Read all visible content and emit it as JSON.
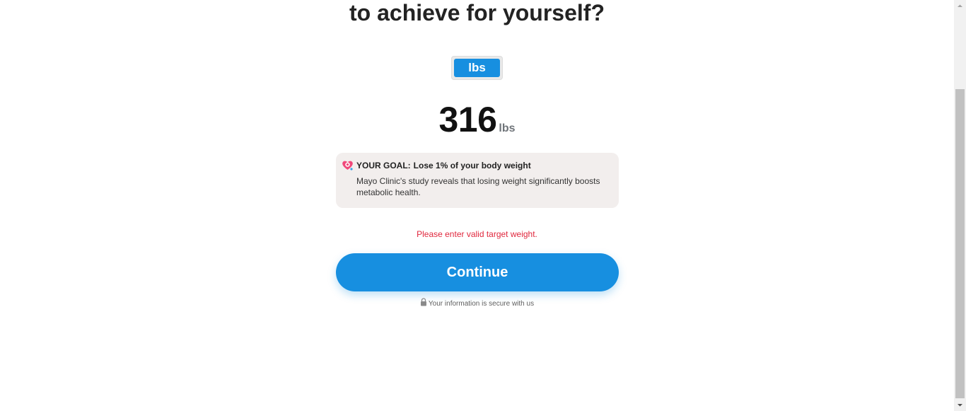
{
  "page": {
    "heading": "to achieve for yourself?",
    "unit_toggle": {
      "selected_unit": "lbs"
    },
    "weight": {
      "value": "316",
      "unit": "lbs"
    },
    "goal_card": {
      "icon": "heart-target-icon",
      "title_prefix": "YOUR GOAL:",
      "title_text": "Lose 1% of your body weight",
      "description": "Mayo Clinic's study reveals that losing weight significantly boosts metabolic health."
    },
    "error_message": "Please enter valid target weight.",
    "continue_label": "Continue",
    "secure_note": "Your information is secure with us"
  },
  "colors": {
    "accent": "#178fe0",
    "error": "#e0273d",
    "card_background": "#f2eeed"
  }
}
